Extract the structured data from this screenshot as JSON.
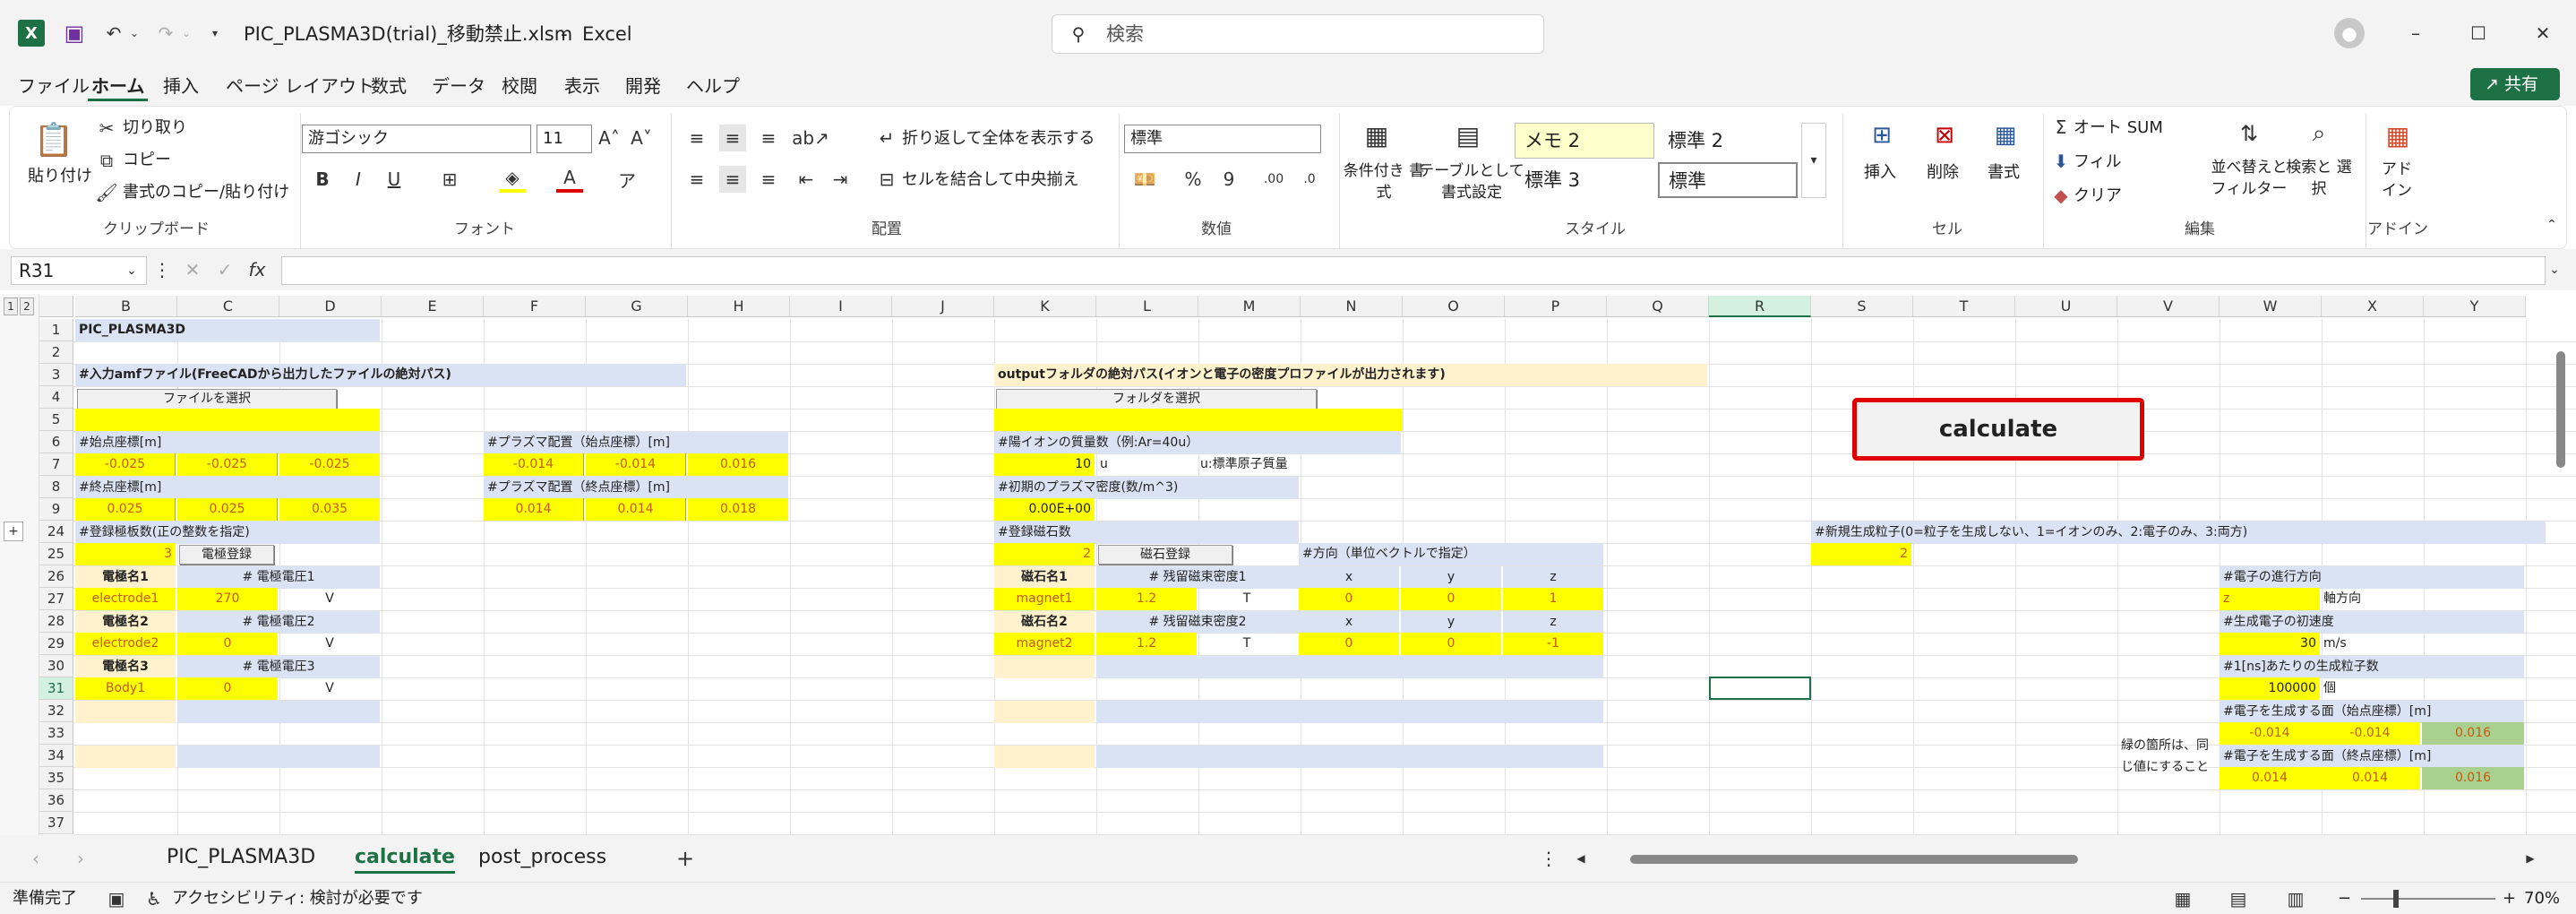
{
  "titlebar": {
    "filename": "PIC_PLASMA3D(trial)_移動禁止.xlsm",
    "dash": "-",
    "app": "Excel",
    "search_placeholder": "検索"
  },
  "menu": [
    "ファイル",
    "ホーム",
    "挿入",
    "ページ レイアウト",
    "数式",
    "データ",
    "校閲",
    "表示",
    "開発",
    "ヘルプ"
  ],
  "share_label": "共有",
  "ribbon": {
    "paste": "貼り付け",
    "cut": "切り取り",
    "copy": "コピー",
    "format_painter": "書式のコピー/貼り付け",
    "grp_clipboard": "クリップボード",
    "font_name": "游ゴシック",
    "font_size": "11",
    "grp_font": "フォント",
    "wrap": "折り返して全体を表示する",
    "merge": "セルを結合して中央揃え",
    "grp_align": "配置",
    "num_format": "標準",
    "grp_number": "数値",
    "cond_format": "条件付き 書式",
    "table_format": "テーブルとして 書式設定",
    "style1": "メモ 2",
    "style2": "標準 2",
    "style3": "標準 3",
    "style4": "標準",
    "grp_style": "スタイル",
    "insert": "挿入",
    "delete": "削除",
    "format": "書式",
    "grp_cells": "セル",
    "autosum": "オート SUM",
    "fill": "フィル",
    "clear": "クリア",
    "sort": "並べ替えと フィルター",
    "find": "検索と 選択",
    "grp_edit": "編集",
    "addin": "アド イン",
    "grp_addin": "アドイン"
  },
  "formula": {
    "namebox": "R31",
    "fx": "fx"
  },
  "columns": [
    "B",
    "C",
    "D",
    "E",
    "F",
    "G",
    "H",
    "I",
    "J",
    "K",
    "L",
    "M",
    "N",
    "O",
    "P",
    "Q",
    "R",
    "S",
    "T",
    "U",
    "V",
    "W",
    "X",
    "Y"
  ],
  "rows": [
    "1",
    "2",
    "3",
    "4",
    "5",
    "6",
    "7",
    "8",
    "9",
    "24",
    "25",
    "26",
    "27",
    "28",
    "29",
    "30",
    "31",
    "32",
    "33",
    "34",
    "35",
    "36",
    "37"
  ],
  "outline": {
    "levels": [
      "1",
      "2"
    ],
    "plus": "+"
  },
  "cells": {
    "b1": "PIC_PLASMA3D",
    "b3": "#入力amfファイル(FreeCADから出力したファイルの絶対パス)",
    "btn_file": "ファイルを選択",
    "b6": "#始点座標[m]",
    "b7": "-0.025",
    "c7": "-0.025",
    "d7": "-0.025",
    "b8": "#終点座標[m]",
    "b9": "0.025",
    "c9": "0.025",
    "d9": "0.035",
    "f6": "#プラズマ配置（始点座標）[m]",
    "f7": "-0.014",
    "g7": "-0.014",
    "h7": "0.016",
    "f8": "#プラズマ配置（終点座標）[m]",
    "f9": "0.014",
    "g9": "0.014",
    "h9": "0.018",
    "k3": "outputフォルダの絶対パス(イオンと電子の密度プロファイルが出力されます)",
    "btn_folder": "フォルダを選択",
    "k6": "#陽イオンの質量数（例:Ar=40u）",
    "k7": "10",
    "l7": "u",
    "m7": "u:標準原子質量",
    "k8": "#初期のプラズマ密度(数/m^3)",
    "k9": "0.00E+00",
    "b24": "#登録極板数(正の整数を指定)",
    "b25": "3",
    "btn_electrode": "電極登録",
    "b26": "電極名1",
    "c26": "# 電極電圧1",
    "b27": "electrode1",
    "c27": "270",
    "d27": "V",
    "b28": "電極名2",
    "c28": "# 電極電圧2",
    "b29": "electrode2",
    "c29": "0",
    "d29": "V",
    "b30": "電極名3",
    "c30": "# 電極電圧3",
    "b31": "Body1",
    "c31": "0",
    "d31": "V",
    "k24": "#登録磁石数",
    "k25": "2",
    "btn_magnet": "磁石登録",
    "n25": "#方向（単位ベクトルで指定）",
    "k26": "磁石名1",
    "l26": "# 残留磁束密度1",
    "n26": "x",
    "o26": "y",
    "p26": "z",
    "k27": "magnet1",
    "l27": "1.2",
    "m27": "T",
    "n27": "0",
    "o27": "0",
    "p27": "1",
    "k28": "磁石名2",
    "l28": "# 残留磁束密度2",
    "n28": "x",
    "o28": "y",
    "p28": "z",
    "k29": "magnet2",
    "l29": "1.2",
    "m29": "T",
    "n29": "0",
    "o29": "0",
    "p29": "-1",
    "s24": "#新規生成粒子(0=粒子を生成しない、1=イオンのみ、2:電子のみ、3:両方)",
    "s25": "2",
    "w26": "#電子の進行方向",
    "w27": "z",
    "x27": "軸方向",
    "w28": "#生成電子の初速度",
    "w29": "30",
    "x29": "m/s",
    "w30": "#1[ns]あたりの生成粒子数",
    "w31": "100000",
    "x31": "個",
    "w32": "#電子を生成する面（始点座標）[m]",
    "w33": "-0.014",
    "x33": "-0.014",
    "y33": "0.016",
    "w34": "#電子を生成する面（終点座標）[m]",
    "w35": "0.014",
    "x35": "0.014",
    "y35": "0.016",
    "note1": "緑の箇所は、同",
    "note2": "じ値にすること",
    "calculate": "calculate"
  },
  "sheets": [
    "PIC_PLASMA3D",
    "calculate",
    "post_process"
  ],
  "status": {
    "ready": "準備完了",
    "accessibility": "アクセシビリティ: 検討が必要です",
    "zoom": "70%",
    "minus": "−",
    "plus": "+"
  }
}
